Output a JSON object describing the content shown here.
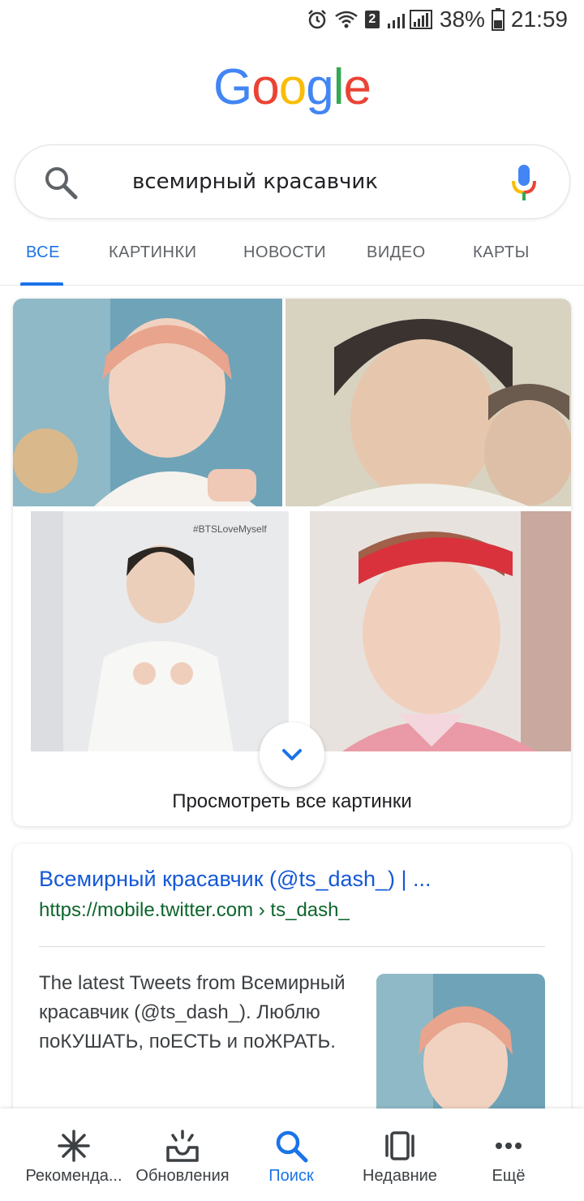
{
  "status_bar": {
    "battery": "38%",
    "time": "21:59",
    "sim": "2"
  },
  "logo": {
    "letters": [
      "G",
      "o",
      "o",
      "g",
      "l",
      "e"
    ],
    "colors": [
      "#4285F4",
      "#EA4335",
      "#FBBC05",
      "#4285F4",
      "#34A853",
      "#EA4335"
    ]
  },
  "search": {
    "query": "всемирный красавчик"
  },
  "tabs": [
    {
      "label": "ВСЕ",
      "active": true
    },
    {
      "label": "КАРТИНКИ",
      "active": false
    },
    {
      "label": "НОВОСТИ",
      "active": false
    },
    {
      "label": "ВИДЕО",
      "active": false
    },
    {
      "label": "КАРТЫ",
      "active": false
    }
  ],
  "images_card": {
    "watermark": "#BTSLoveMyself",
    "view_all_label": "Просмотреть все картинки"
  },
  "result": {
    "title": "Всемирный красавчик (@ts_dash_) | ...",
    "url": "https://mobile.twitter.com › ts_dash_",
    "snippet": "The latest Tweets from Всемирный красавчик (@ts_dash_). Люблю поКУШАТЬ, поЕСТЬ и поЖРАТЬ."
  },
  "bottom_nav": [
    {
      "label": "Рекоменда...",
      "icon": "asterisk-icon",
      "active": false
    },
    {
      "label": "Обновления",
      "icon": "inbox-icon",
      "active": false
    },
    {
      "label": "Поиск",
      "icon": "search-icon",
      "active": true
    },
    {
      "label": "Недавние",
      "icon": "recent-icon",
      "active": false
    },
    {
      "label": "Ещё",
      "icon": "more-icon",
      "active": false
    }
  ],
  "accent_color": "#1a73e8"
}
